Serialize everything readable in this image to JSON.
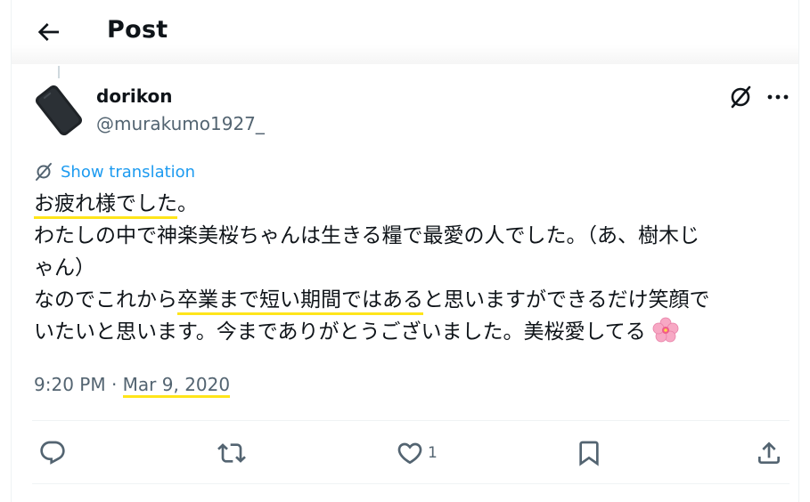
{
  "header": {
    "title": "Post",
    "back_icon": "arrow-left-icon"
  },
  "author": {
    "display_name": "dorikon",
    "handle": "@murakumo1927_",
    "avatar_icon": "phone-avatar"
  },
  "actions_top": {
    "grok_icon": "grok-slash-icon",
    "more_icon": "more-dots-icon"
  },
  "translate": {
    "label": "Show translation",
    "icon": "translate-icon"
  },
  "tweet": {
    "line1_highlight": "お疲れ様でした",
    "line1_rest": "。",
    "line2": "わたしの中で神楽美桜ちゃんは生きる糧で最愛の人でした。（あ、樹木じ",
    "line3": "ゃん）",
    "line4_pre": "なのでこれから",
    "line4_highlight": "卒業まで短い期間ではある",
    "line4_post": "と思いますができるだけ笑顔で",
    "line5": "いたいと思います。今までありがとうございました。美桜愛してる",
    "emoji": "cherry-blossom-emoji"
  },
  "meta": {
    "time": "9:20 PM",
    "separator": "·",
    "date": "Mar 9, 2020"
  },
  "engagement": {
    "reply_icon": "reply-icon",
    "repost_icon": "repost-icon",
    "like_icon": "heart-icon",
    "like_count": "1",
    "bookmark_icon": "bookmark-icon",
    "share_icon": "share-icon"
  },
  "colors": {
    "accent": "#1d9bf0",
    "highlight": "#ffe51a",
    "muted": "#536471",
    "text": "#0f1419"
  }
}
